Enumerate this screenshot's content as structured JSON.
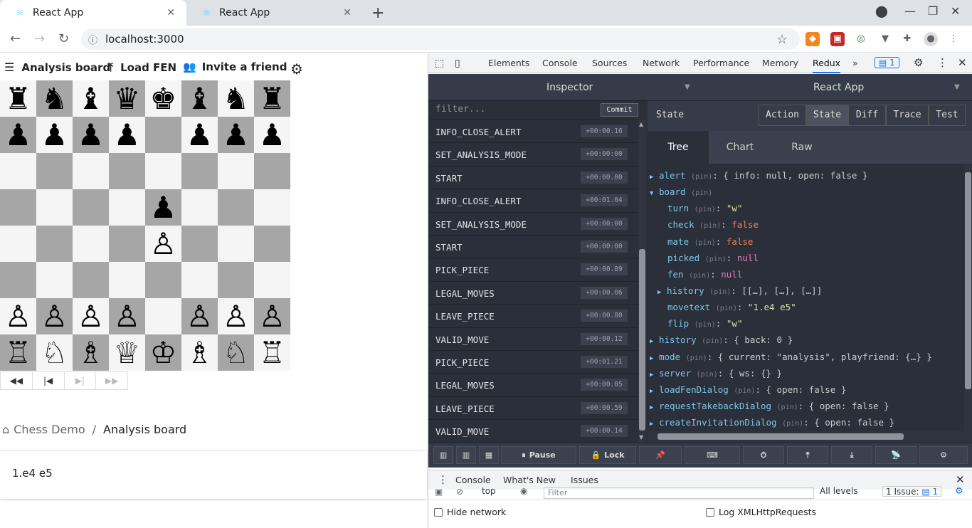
{
  "browser": {
    "tabs": [
      {
        "title": "React App"
      },
      {
        "title": "React App"
      }
    ],
    "url": "localhost:3000"
  },
  "toolbar": {
    "analysis_board": "Analysis board",
    "load_fen": "Load FEN",
    "invite_friend": "Invite a friend"
  },
  "board": {
    "ranks": [
      [
        "♜",
        "♞",
        "♝",
        "♛",
        "♚",
        "♝",
        "♞",
        "♜"
      ],
      [
        "♟",
        "♟",
        "♟",
        "♟",
        "",
        "♟",
        "♟",
        "♟"
      ],
      [
        "",
        "",
        "",
        "",
        "",
        "",
        "",
        ""
      ],
      [
        "",
        "",
        "",
        "",
        "♟",
        "",
        "",
        ""
      ],
      [
        "",
        "",
        "",
        "",
        "♙",
        "",
        "",
        ""
      ],
      [
        "",
        "",
        "",
        "",
        "",
        "",
        "",
        ""
      ],
      [
        "♙",
        "♙",
        "♙",
        "♙",
        "",
        "♙",
        "♙",
        "♙"
      ],
      [
        "♖",
        "♘",
        "♗",
        "♕",
        "♔",
        "♗",
        "♘",
        "♖"
      ]
    ]
  },
  "breadcrumb": {
    "root": "Chess Demo",
    "sep": "/",
    "current": "Analysis board"
  },
  "moves": {
    "text": "1.e4 e5"
  },
  "devtools": {
    "tabs": [
      "Elements",
      "Console",
      "Sources",
      "Network",
      "Performance",
      "Memory",
      "Redux"
    ],
    "badge": "1",
    "redux": {
      "inspector": "Inspector",
      "instance": "React App",
      "filter_placeholder": "filter...",
      "commit": "Commit",
      "actions": [
        {
          "name": "INFO_CLOSE_ALERT",
          "time": "+00:00.16"
        },
        {
          "name": "SET_ANALYSIS_MODE",
          "time": "+00:00:00"
        },
        {
          "name": "START",
          "time": "+00:00.00"
        },
        {
          "name": "INFO_CLOSE_ALERT",
          "time": "+00:01.04"
        },
        {
          "name": "SET_ANALYSIS_MODE",
          "time": "+00:00:00"
        },
        {
          "name": "START",
          "time": "+00:00:00"
        },
        {
          "name": "PICK_PIECE",
          "time": "+00:00.89"
        },
        {
          "name": "LEGAL_MOVES",
          "time": "+00:00.06"
        },
        {
          "name": "LEAVE_PIECE",
          "time": "+00:00.80"
        },
        {
          "name": "VALID_MOVE",
          "time": "+00:00.12"
        },
        {
          "name": "PICK_PIECE",
          "time": "+00:01.21"
        },
        {
          "name": "LEGAL_MOVES",
          "time": "+00:00.05"
        },
        {
          "name": "LEAVE_PIECE",
          "time": "+00:00.59"
        },
        {
          "name": "VALID_MOVE",
          "time": "+00:00.14"
        }
      ],
      "state_title": "State",
      "modes": [
        "Action",
        "State",
        "Diff",
        "Trace",
        "Test"
      ],
      "views": [
        "Tree",
        "Chart",
        "Raw"
      ],
      "pin": "(pin)",
      "tree": {
        "alert_key": "alert",
        "alert_val": "{ info: null, open: false }",
        "board_key": "board",
        "turn_key": "turn",
        "turn_val": "\"w\"",
        "check_key": "check",
        "check_val": "false",
        "mate_key": "mate",
        "mate_val": "false",
        "picked_key": "picked",
        "picked_val": "null",
        "fen_key": "fen",
        "fen_val": "null",
        "bhistory_key": "history",
        "bhistory_val": "[[…], […], […]]",
        "movetext_key": "movetext",
        "movetext_val": "\"1.e4 e5\"",
        "flip_key": "flip",
        "flip_val": "\"w\"",
        "history_key": "history",
        "history_val": "{ back: 0 }",
        "mode_key": "mode",
        "mode_val": "{ current: \"analysis\", playfriend: {…} }",
        "server_key": "server",
        "server_val": "{ ws: {} }",
        "loadfen_key": "loadFenDialog",
        "loadfen_val": "{ open: false }",
        "takeback_key": "requestTakebackDialog",
        "takeback_val": "{ open: false }",
        "invite_key": "createInvitationDialog",
        "invite_val": "{ open: false }"
      },
      "pause": "Pause",
      "lock": "Lock"
    },
    "drawer": {
      "tabs": [
        "Console",
        "What's New",
        "Issues"
      ],
      "filter_placeholder": "Filter",
      "context": "top",
      "levels": "All levels",
      "issues": "1 Issue:",
      "hide_network": "Hide network",
      "log_xhr": "Log XMLHttpRequests"
    }
  }
}
